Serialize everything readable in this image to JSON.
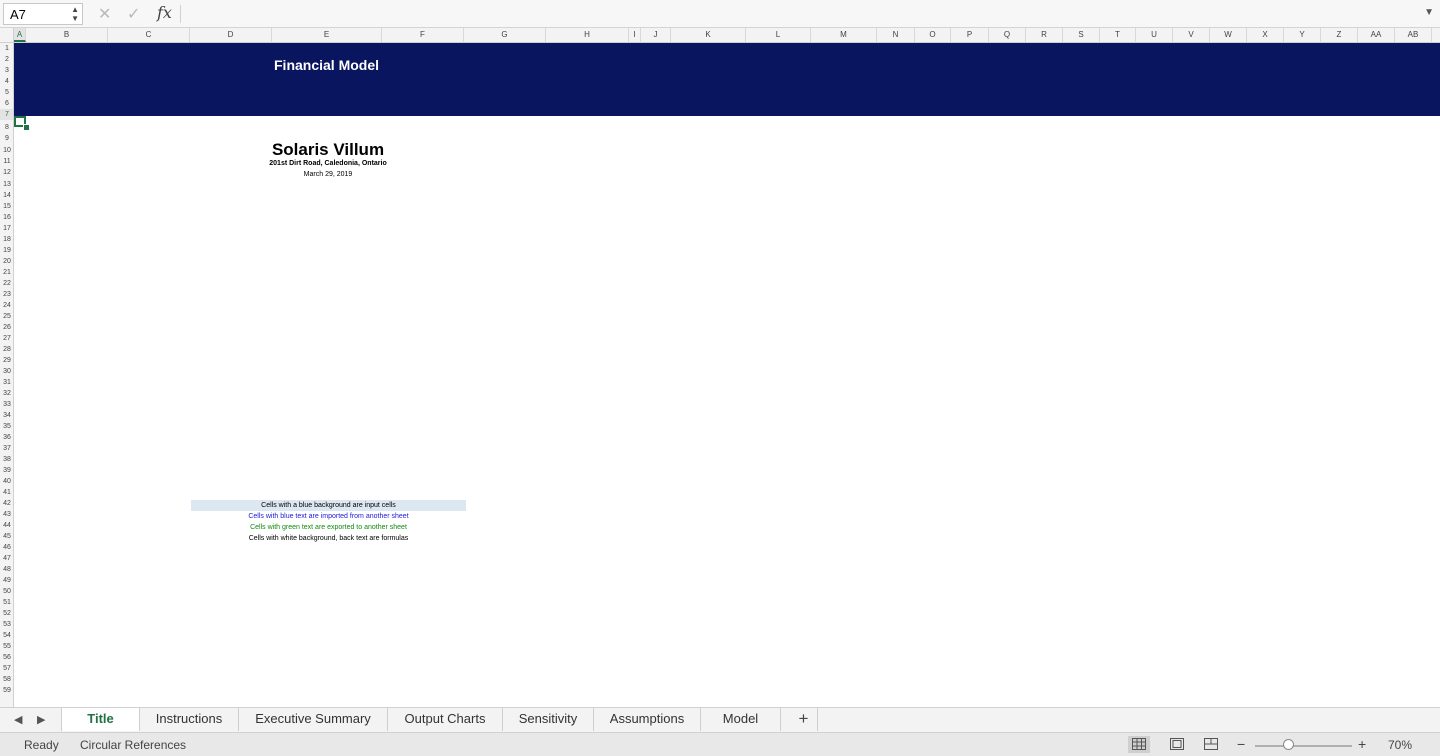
{
  "formula_bar": {
    "name_box": "A7",
    "formula": "",
    "icons": [
      "cancel-icon",
      "confirm-icon",
      "function-icon"
    ]
  },
  "grid": {
    "columns": [
      "A",
      "B",
      "C",
      "D",
      "E",
      "F",
      "G",
      "H",
      "I",
      "J",
      "K",
      "L",
      "M",
      "N",
      "O",
      "P",
      "Q",
      "R",
      "S",
      "T",
      "U",
      "V",
      "W",
      "X",
      "Y",
      "Z",
      "AA",
      "AB"
    ],
    "active_column": "A",
    "active_row": 7,
    "row_count": 59
  },
  "content": {
    "banner_title": "Financial Model",
    "company_name": "Solaris Villum",
    "company_address": "201st Dirt Road, Caledonia, Ontario",
    "company_date": "March 29, 2019",
    "banner_color": "#0a1560"
  },
  "legend": {
    "input": "Cells with a blue background are input cells",
    "import": "Cells with blue text are imported from another sheet",
    "export": "Cells with green text are exported to another sheet",
    "formula": "Cells with white background, back text are formulas",
    "colors": {
      "input_bg": "#dde7f1",
      "import_text": "#1a1ad8",
      "export_text": "#118a11"
    }
  },
  "sheet_tabs": {
    "tabs": [
      "Title",
      "Instructions",
      "Executive Summary",
      "Output Charts",
      "Sensitivity",
      "Assumptions",
      "Model"
    ],
    "active": "Title"
  },
  "status_bar": {
    "ready": "Ready",
    "circular": "Circular References",
    "zoom": "70%",
    "zoom_fraction": 0.3,
    "accent": "#217346"
  }
}
